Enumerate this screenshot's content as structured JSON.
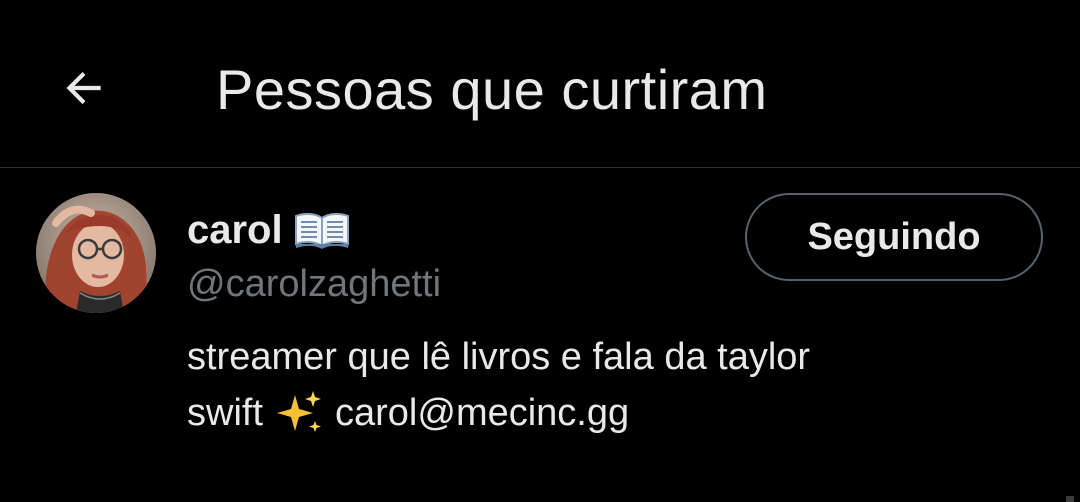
{
  "header": {
    "back_icon": "arrow-left-icon",
    "title": "Pessoas que curtiram"
  },
  "user": {
    "display_name": "carol",
    "name_emoji": "open-book-icon",
    "handle": "@carolzaghetti",
    "bio_line1": "streamer que lê livros e fala da taylor",
    "bio_line2_before": "swift",
    "bio_emoji": "sparkles-icon",
    "bio_line2_after": "carol@mecinc.gg",
    "follow_label": "Seguindo"
  },
  "colors": {
    "background": "#000000",
    "primary_text": "#e7e9ea",
    "secondary_text": "#71767b",
    "divider": "#2f3336",
    "button_border": "#536471"
  }
}
